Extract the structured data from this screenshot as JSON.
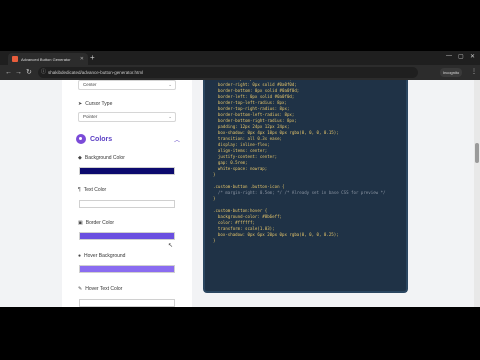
{
  "browser": {
    "tab_title": "Advanced Button Generator",
    "url": "shakibdedicated/advance-button-generator.html",
    "profile": "Incognito"
  },
  "panel": {
    "top_select": "Center",
    "cursor_label": "Cursor Type",
    "cursor_value": "Pointer",
    "section_title": "Colors",
    "bg_label": "Background Color",
    "text_label": "Text Color",
    "border_label": "Border Color",
    "hover_bg_label": "Hover Background",
    "hover_text_label": "Hover Text Color"
  },
  "swatch_colors": {
    "background": "#0c0a6e",
    "text": "#ffffff",
    "border": "#6a4fe0",
    "hover_background": "#8a6cf0"
  },
  "code": [
    "  border-top: 0px solid #0a0f0d;",
    "  border-right: 0px solid #0a0f0d;",
    "  border-bottom: 0px solid #0a0f0d;",
    "  border-left: 0px solid #0a0f0d;",
    "  border-top-left-radius: 8px;",
    "  border-top-right-radius: 8px;",
    "  border-bottom-left-radius: 8px;",
    "  border-bottom-right-radius: 8px;",
    "  padding: 12px 24px 12px 24px;",
    "  box-shadow: 0px 4px 10px 0px rgba(0, 0, 0, 0.15);",
    "  transition: all 0.3s ease;",
    "  display: inline-flex;",
    "  align-items: center;",
    "  justify-content: center;",
    "  gap: 0.5rem;",
    "  white-space: nowrap;",
    "}",
    "",
    ".custom-button .button-icon {",
    "  /* margin-right: 0.5em; */ /* Already set in base CSS for preview */",
    "}",
    "",
    ".custom-button:hover {",
    "  background-color: #8b6eff;",
    "  color: #ffffff;",
    "  transform: scale(1.03);",
    "  box-shadow: 0px 6px 20px 0px rgba(0, 0, 0, 0.25);",
    "}"
  ]
}
